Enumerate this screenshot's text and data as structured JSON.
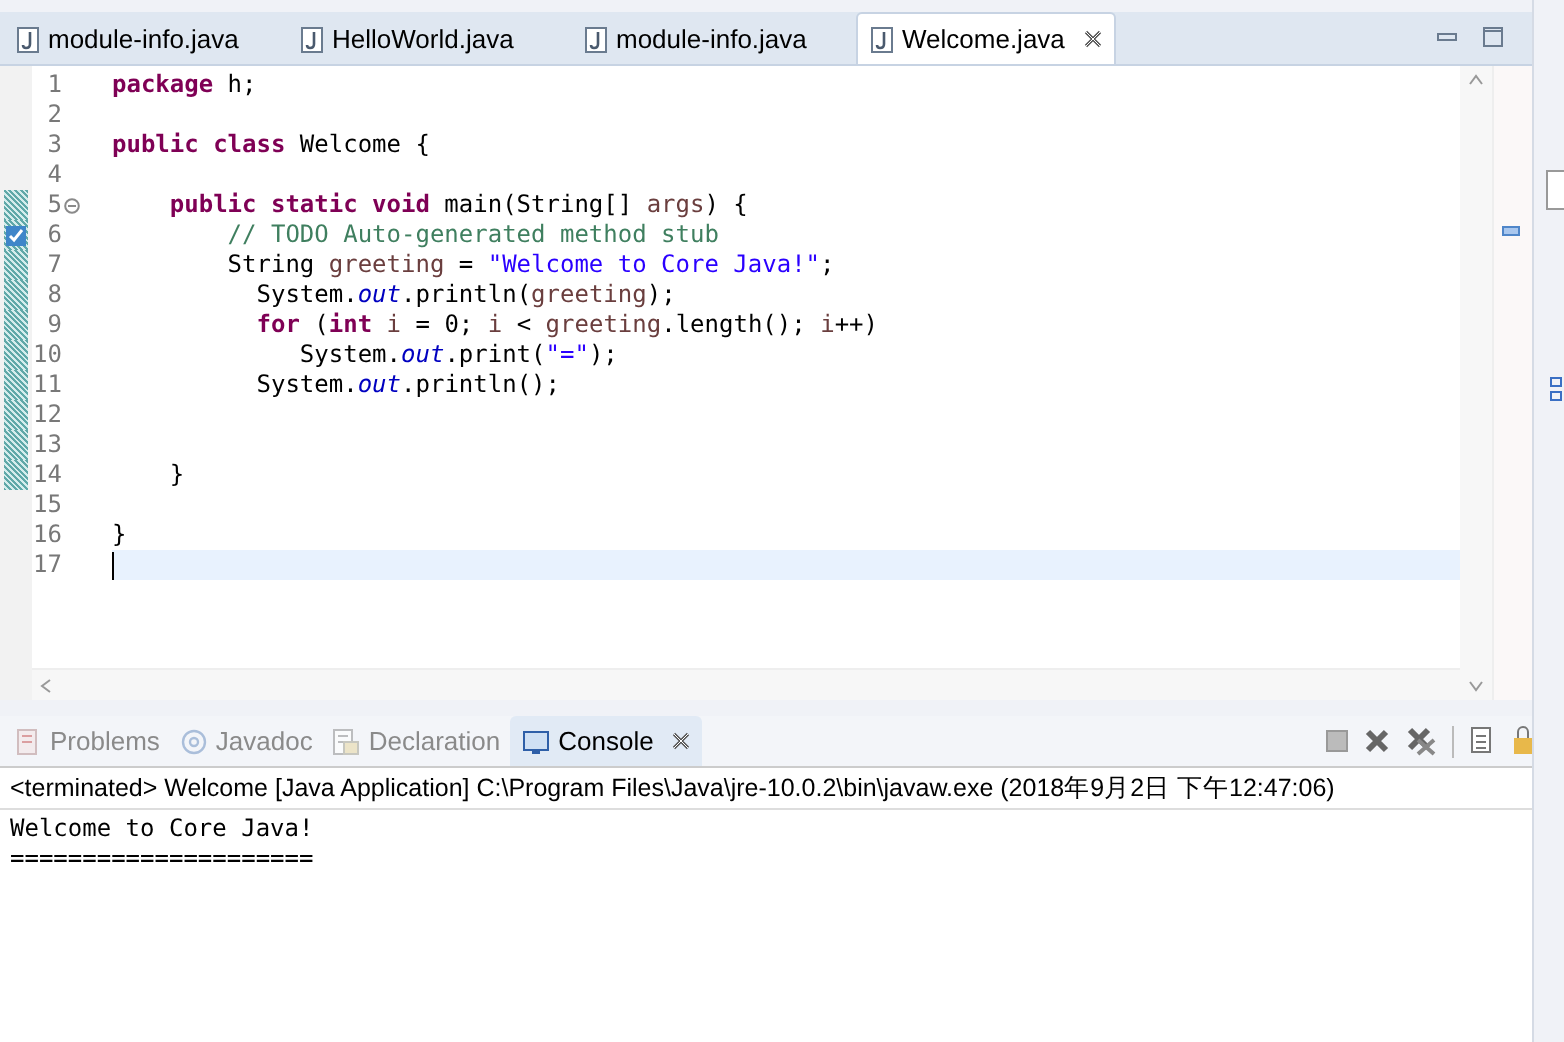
{
  "editor_tabs": [
    {
      "label": "module-info.java",
      "selected": false
    },
    {
      "label": "HelloWorld.java",
      "selected": false
    },
    {
      "label": "module-info.java",
      "selected": false
    },
    {
      "label": "Welcome.java",
      "selected": true
    }
  ],
  "code_lines": [
    {
      "number": "1",
      "tokens": [
        {
          "kind": "kw",
          "text": "package"
        },
        {
          "kind": "plain",
          "text": " h;"
        }
      ]
    },
    {
      "number": "2"
    },
    {
      "number": "3",
      "tokens": [
        {
          "kind": "kw",
          "text": "public class"
        },
        {
          "kind": "plain",
          "text": " Welcome {"
        }
      ]
    },
    {
      "number": "4"
    },
    {
      "number": "5",
      "foldable": true,
      "changed": true,
      "tokens": [
        {
          "kind": "kw",
          "text": "    public static void"
        },
        {
          "kind": "plain",
          "text": " main(String[] "
        },
        {
          "kind": "var",
          "text": "args"
        },
        {
          "kind": "plain",
          "text": ") {"
        }
      ]
    },
    {
      "number": "6",
      "task_marker": true,
      "changed": true,
      "tokens": [
        {
          "kind": "comment",
          "text": "        // TODO Auto-generated method stub"
        }
      ]
    },
    {
      "number": "7",
      "changed": true,
      "tokens": [
        {
          "kind": "plain",
          "text": "        String "
        },
        {
          "kind": "var",
          "text": "greeting"
        },
        {
          "kind": "plain",
          "text": " = "
        },
        {
          "kind": "string",
          "text": "\"Welcome to Core Java!\""
        },
        {
          "kind": "plain",
          "text": ";"
        }
      ]
    },
    {
      "number": "8",
      "changed": true,
      "tokens": [
        {
          "kind": "plain",
          "text": "          System."
        },
        {
          "kind": "field",
          "text": "out"
        },
        {
          "kind": "plain",
          "text": ".println("
        },
        {
          "kind": "var",
          "text": "greeting"
        },
        {
          "kind": "plain",
          "text": ");"
        }
      ]
    },
    {
      "number": "9",
      "changed": true,
      "tokens": [
        {
          "kind": "kw",
          "text": "          for"
        },
        {
          "kind": "plain",
          "text": " ("
        },
        {
          "kind": "kw",
          "text": "int"
        },
        {
          "kind": "var",
          "text": " i"
        },
        {
          "kind": "plain",
          "text": " = 0; "
        },
        {
          "kind": "var",
          "text": "i"
        },
        {
          "kind": "plain",
          "text": " < "
        },
        {
          "kind": "var",
          "text": "greeting"
        },
        {
          "kind": "plain",
          "text": ".length(); "
        },
        {
          "kind": "var",
          "text": "i"
        },
        {
          "kind": "plain",
          "text": "++)"
        }
      ]
    },
    {
      "number": "10",
      "changed": true,
      "tokens": [
        {
          "kind": "plain",
          "text": "             System."
        },
        {
          "kind": "field",
          "text": "out"
        },
        {
          "kind": "plain",
          "text": ".print("
        },
        {
          "kind": "string",
          "text": "\"=\""
        },
        {
          "kind": "plain",
          "text": ");"
        }
      ]
    },
    {
      "number": "11",
      "changed": true,
      "tokens": [
        {
          "kind": "plain",
          "text": "          System."
        },
        {
          "kind": "field",
          "text": "out"
        },
        {
          "kind": "plain",
          "text": ".println();"
        }
      ]
    },
    {
      "number": "12",
      "changed": true
    },
    {
      "number": "13",
      "changed": true
    },
    {
      "number": "14",
      "changed": true,
      "tokens": [
        {
          "kind": "plain",
          "text": "    }"
        }
      ]
    },
    {
      "number": "15"
    },
    {
      "number": "16",
      "tokens": [
        {
          "kind": "plain",
          "text": "}"
        }
      ]
    },
    {
      "number": "17",
      "current": true
    }
  ],
  "bottom_tabs": [
    {
      "label": "Problems",
      "selected": false
    },
    {
      "label": "Javadoc",
      "selected": false
    },
    {
      "label": "Declaration",
      "selected": false
    },
    {
      "label": "Console",
      "selected": true
    }
  ],
  "console": {
    "header": "<terminated> Welcome [Java Application] C:\\Program Files\\Java\\jre-10.0.2\\bin\\javaw.exe (2018年9月2日 下午12:47:06)",
    "output": [
      "Welcome to Core Java!",
      "====================="
    ]
  }
}
